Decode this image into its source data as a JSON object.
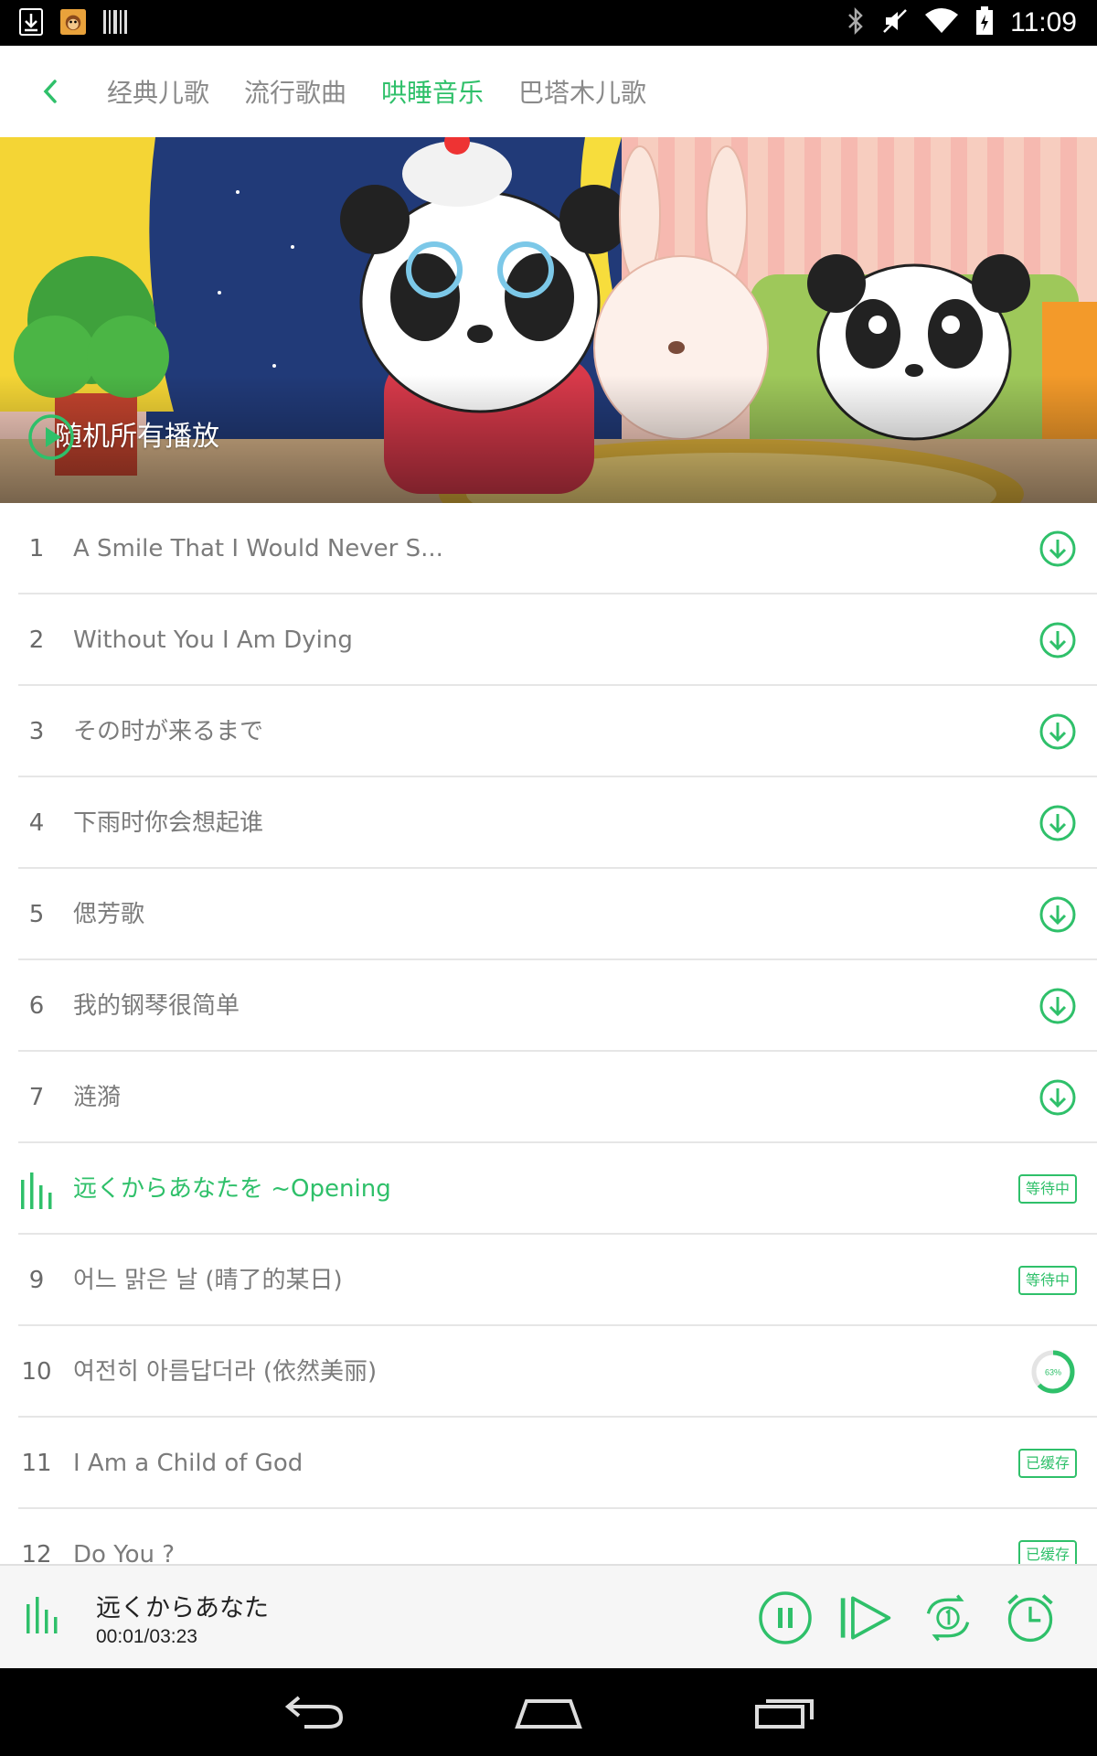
{
  "status_bar": {
    "time": "11:09",
    "left_icons": [
      "download-icon",
      "monkey-app-icon",
      "barcode-icon"
    ],
    "right_icons": [
      "bluetooth-icon",
      "mute-icon",
      "wifi-icon",
      "battery-icon"
    ]
  },
  "header": {
    "tabs": [
      {
        "label": "经典儿歌",
        "active": false
      },
      {
        "label": "流行歌曲",
        "active": false
      },
      {
        "label": "哄睡音乐",
        "active": true
      },
      {
        "label": "巴塔木儿歌",
        "active": false
      }
    ]
  },
  "banner": {
    "play_all_label": "随机所有播放"
  },
  "songs": [
    {
      "num": "1",
      "title": "A Smile That I Would Never S...",
      "status": "download"
    },
    {
      "num": "2",
      "title": "Without You I Am Dying",
      "status": "download"
    },
    {
      "num": "3",
      "title": "その时が来るまで",
      "status": "download"
    },
    {
      "num": "4",
      "title": "下雨时你会想起谁",
      "status": "download"
    },
    {
      "num": "5",
      "title": "偲芳歌",
      "status": "download"
    },
    {
      "num": "6",
      "title": "我的钢琴很简单",
      "status": "download"
    },
    {
      "num": "7",
      "title": "涟漪",
      "status": "download"
    },
    {
      "num": "",
      "title": "远くからあなたを ~Opening",
      "status": "waiting",
      "badge": "等待中",
      "playing": true
    },
    {
      "num": "9",
      "title": "어느 맑은 날 (晴了的某日)",
      "status": "waiting",
      "badge": "等待中"
    },
    {
      "num": "10",
      "title": "여전히 아름답더라 (依然美丽)",
      "status": "progress",
      "progress_label": "63%",
      "progress": 0.63
    },
    {
      "num": "11",
      "title": "I Am a Child of God",
      "status": "cached",
      "badge": "已缓存"
    },
    {
      "num": "12",
      "title": "Do You ?",
      "status": "cached",
      "badge": "已缓存"
    }
  ],
  "player": {
    "title": "远くからあなた",
    "time": "00:01/03:23"
  },
  "colors": {
    "accent": "#2fc06a",
    "text_muted": "#7b7b7b",
    "divider": "#e6e6e6"
  }
}
